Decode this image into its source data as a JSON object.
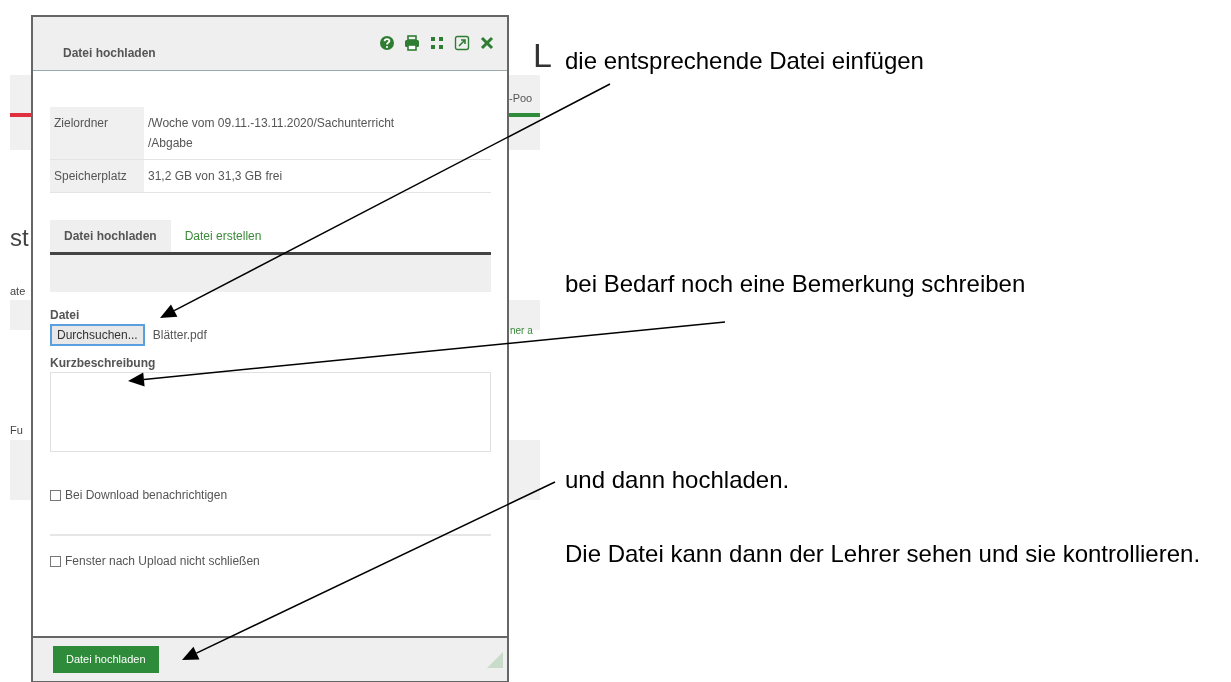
{
  "background_page": {
    "fragments": [
      {
        "kind": "heading",
        "text": "L"
      },
      {
        "kind": "tab",
        "text": "-Poo"
      },
      {
        "kind": "title",
        "text": "st"
      },
      {
        "kind": "label",
        "text": "ate"
      },
      {
        "kind": "link",
        "text": "ner a"
      },
      {
        "kind": "label",
        "text": "Fu"
      }
    ]
  },
  "dialog": {
    "title": "Datei hochladen",
    "info": [
      {
        "label": "Zielordner",
        "value_lines": [
          "/Woche vom 09.11.-13.11.2020/Sachunterricht",
          "/Abgabe"
        ]
      },
      {
        "label": "Speicherplatz",
        "value_lines": [
          "31,2 GB von 31,3 GB frei"
        ]
      }
    ],
    "tabs": [
      {
        "label": "Datei hochladen",
        "selected": true
      },
      {
        "label": "Datei erstellen",
        "selected": false
      }
    ],
    "file": {
      "label": "Datei",
      "button": "Durchsuchen...",
      "filename": "Blätter.pdf"
    },
    "description": {
      "label": "Kurzbeschreibung"
    },
    "options": [
      {
        "label": "Bei Download benachrichtigen",
        "checked": false
      },
      {
        "label": "Fenster nach Upload nicht schließen",
        "checked": false
      }
    ],
    "submit": "Datei hochladen"
  },
  "annotations": [
    {
      "text": "die entsprechende Datei einfügen"
    },
    {
      "text": "bei Bedarf noch eine Bemerkung schreiben"
    },
    {
      "text": "und dann hochladen."
    },
    {
      "text": "Die Datei kann dann der Lehrer sehen und sie kontrollieren."
    }
  ]
}
